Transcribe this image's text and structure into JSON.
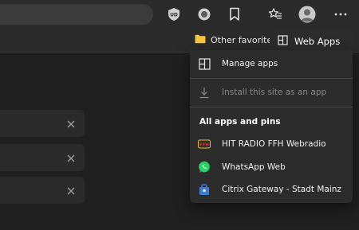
{
  "favorites_bar": {
    "other_favorites_label": "Other favorites"
  },
  "web_apps": {
    "title": "Web Apps",
    "manage_label": "Manage apps",
    "install_label": "Install this site as an app",
    "section_title": "All apps and pins",
    "apps": [
      {
        "label": "HIT RADIO FFH Webradio",
        "icon": "ffh-radio-icon"
      },
      {
        "label": "WhatsApp Web",
        "icon": "whatsapp-icon"
      },
      {
        "label": "Citrix Gateway - Stadt Mainz",
        "icon": "citrix-icon"
      }
    ]
  },
  "colors": {
    "accent": "#7fb2ff",
    "whatsapp": "#25d366",
    "citrix": "#3a7bd5",
    "folder": "#f5c542"
  }
}
